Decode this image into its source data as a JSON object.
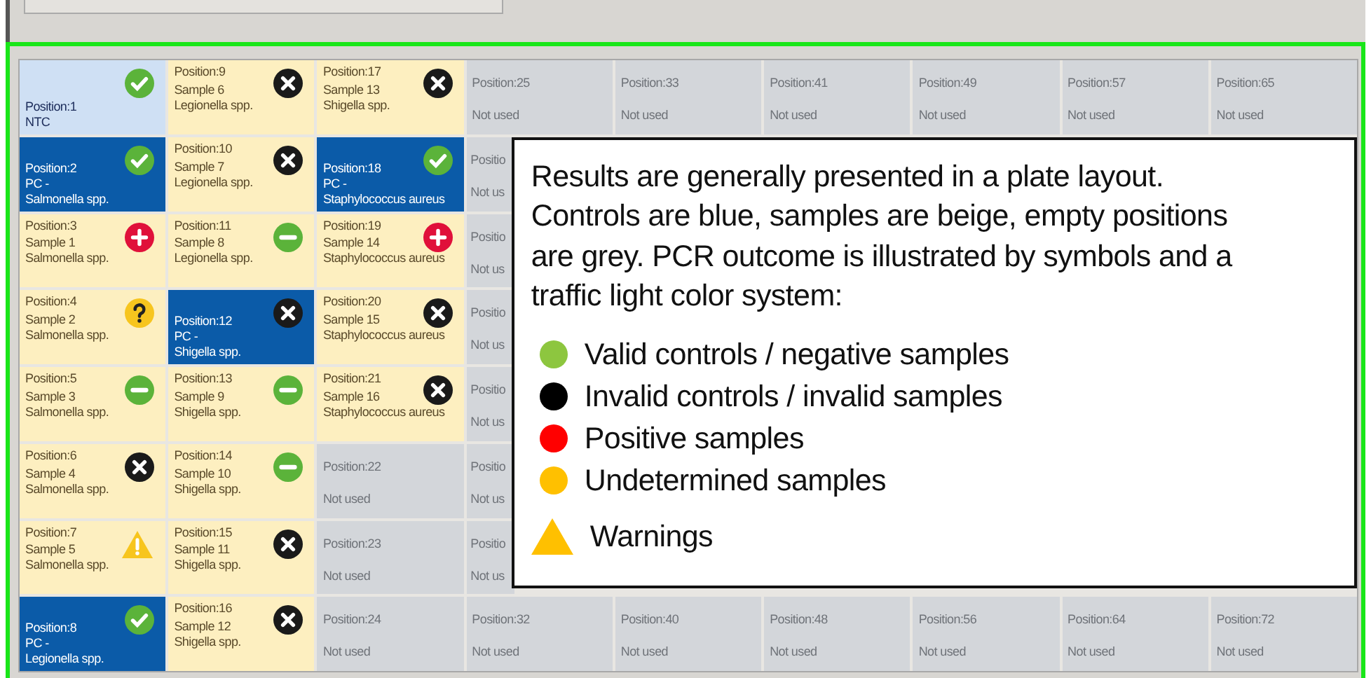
{
  "plate": {
    "columns": [
      [
        {
          "kind": "ntc",
          "position": "Position:1",
          "lines": [
            "NTC"
          ],
          "icon": {
            "kind": "check"
          }
        },
        {
          "kind": "control",
          "position": "Position:2",
          "lines": [
            "PC -",
            "Salmonella spp."
          ],
          "icon": {
            "kind": "check"
          }
        },
        {
          "kind": "sample",
          "position": "Position:3",
          "lines": [
            "Sample 1",
            "Salmonella spp."
          ],
          "icon": {
            "kind": "plus"
          }
        },
        {
          "kind": "sample",
          "position": "Position:4",
          "lines": [
            "Sample 2",
            "Salmonella spp."
          ],
          "icon": {
            "kind": "question"
          }
        },
        {
          "kind": "sample",
          "position": "Position:5",
          "lines": [
            "Sample 3",
            "Salmonella spp."
          ],
          "icon": {
            "kind": "minus"
          }
        },
        {
          "kind": "sample",
          "position": "Position:6",
          "lines": [
            "Sample 4",
            "Salmonella spp."
          ],
          "icon": {
            "kind": "cross"
          }
        },
        {
          "kind": "sample",
          "position": "Position:7",
          "lines": [
            "Sample 5",
            "Salmonella spp."
          ],
          "icon": {
            "kind": "warning"
          }
        },
        {
          "kind": "control",
          "position": "Position:8",
          "lines": [
            "PC -",
            "Legionella spp."
          ],
          "icon": {
            "kind": "check"
          }
        }
      ],
      [
        {
          "kind": "sample",
          "position": "Position:9",
          "lines": [
            "Sample 6",
            "Legionella spp."
          ],
          "icon": {
            "kind": "cross"
          }
        },
        {
          "kind": "sample",
          "position": "Position:10",
          "lines": [
            "Sample 7",
            "Legionella spp."
          ],
          "icon": {
            "kind": "cross"
          }
        },
        {
          "kind": "sample",
          "position": "Position:11",
          "lines": [
            "Sample 8",
            "Legionella spp."
          ],
          "icon": {
            "kind": "minus"
          }
        },
        {
          "kind": "control",
          "position": "Position:12",
          "lines": [
            "PC -",
            "Shigella spp."
          ],
          "icon": {
            "kind": "cross"
          }
        },
        {
          "kind": "sample",
          "position": "Position:13",
          "lines": [
            "Sample 9",
            "Shigella spp."
          ],
          "icon": {
            "kind": "minus"
          }
        },
        {
          "kind": "sample",
          "position": "Position:14",
          "lines": [
            "Sample 10",
            "Shigella spp."
          ],
          "icon": {
            "kind": "minus"
          }
        },
        {
          "kind": "sample",
          "position": "Position:15",
          "lines": [
            "Sample 11",
            "Shigella spp."
          ],
          "icon": {
            "kind": "cross"
          }
        },
        {
          "kind": "sample",
          "position": "Position:16",
          "lines": [
            "Sample 12",
            "Shigella spp."
          ],
          "icon": {
            "kind": "cross"
          }
        }
      ],
      [
        {
          "kind": "sample",
          "position": "Position:17",
          "lines": [
            "Sample 13",
            "Shigella spp."
          ],
          "icon": {
            "kind": "cross"
          }
        },
        {
          "kind": "control",
          "position": "Position:18",
          "lines": [
            "PC -",
            "Staphylococcus aureus"
          ],
          "icon": {
            "kind": "check"
          }
        },
        {
          "kind": "sample",
          "position": "Position:19",
          "lines": [
            "Sample 14",
            "Staphylococcus aureus"
          ],
          "icon": {
            "kind": "plus"
          }
        },
        {
          "kind": "sample",
          "position": "Position:20",
          "lines": [
            "Sample 15",
            "Staphylococcus aureus"
          ],
          "icon": {
            "kind": "cross"
          }
        },
        {
          "kind": "sample",
          "position": "Position:21",
          "lines": [
            "Sample 16",
            "Staphylococcus aureus"
          ],
          "icon": {
            "kind": "cross"
          }
        },
        {
          "kind": "unused",
          "position": "Position:22",
          "note": "Not used"
        },
        {
          "kind": "unused",
          "position": "Position:23",
          "note": "Not used"
        },
        {
          "kind": "unused",
          "position": "Position:24",
          "note": "Not used"
        }
      ],
      [
        {
          "kind": "unused",
          "position": "Position:25",
          "note": "Not used"
        },
        {
          "kind": "clipped",
          "position": "Positio",
          "note": "Not us"
        },
        {
          "kind": "clipped",
          "position": "Positio",
          "note": "Not us"
        },
        {
          "kind": "clipped",
          "position": "Positio",
          "note": "Not us"
        },
        {
          "kind": "clipped",
          "position": "Positio",
          "note": "Not us"
        },
        {
          "kind": "clipped",
          "position": "Positio",
          "note": "Not us"
        },
        {
          "kind": "clipped",
          "position": "Positio",
          "note": "Not us"
        },
        {
          "kind": "unused",
          "position": "Position:32",
          "note": "Not used"
        }
      ],
      [
        {
          "kind": "unused",
          "position": "Position:33",
          "note": "Not used"
        },
        {
          "kind": "covered"
        },
        {
          "kind": "covered"
        },
        {
          "kind": "covered"
        },
        {
          "kind": "covered"
        },
        {
          "kind": "covered"
        },
        {
          "kind": "covered"
        },
        {
          "kind": "unused",
          "position": "Position:40",
          "note": "Not used"
        }
      ],
      [
        {
          "kind": "unused",
          "position": "Position:41",
          "note": "Not used"
        },
        {
          "kind": "covered"
        },
        {
          "kind": "covered"
        },
        {
          "kind": "covered"
        },
        {
          "kind": "covered"
        },
        {
          "kind": "covered"
        },
        {
          "kind": "covered"
        },
        {
          "kind": "unused",
          "position": "Position:48",
          "note": "Not used"
        }
      ],
      [
        {
          "kind": "unused",
          "position": "Position:49",
          "note": "Not used"
        },
        {
          "kind": "covered"
        },
        {
          "kind": "covered"
        },
        {
          "kind": "covered"
        },
        {
          "kind": "covered"
        },
        {
          "kind": "covered"
        },
        {
          "kind": "covered"
        },
        {
          "kind": "unused",
          "position": "Position:56",
          "note": "Not used"
        }
      ],
      [
        {
          "kind": "unused",
          "position": "Position:57",
          "note": "Not used"
        },
        {
          "kind": "covered"
        },
        {
          "kind": "covered"
        },
        {
          "kind": "covered"
        },
        {
          "kind": "covered"
        },
        {
          "kind": "covered"
        },
        {
          "kind": "covered"
        },
        {
          "kind": "unused",
          "position": "Position:64",
          "note": "Not used"
        }
      ],
      [
        {
          "kind": "unused",
          "position": "Position:65",
          "note": "Not used"
        },
        {
          "kind": "covered"
        },
        {
          "kind": "covered"
        },
        {
          "kind": "covered"
        },
        {
          "kind": "covered"
        },
        {
          "kind": "covered"
        },
        {
          "kind": "covered"
        },
        {
          "kind": "unused",
          "position": "Position:72",
          "note": "Not used"
        }
      ]
    ]
  },
  "callout": {
    "text": "Results are generally presented in a plate layout. Controls are blue, samples are beige, empty positions are grey. PCR outcome is illustrated by symbols and a traffic light color system:",
    "legend": [
      {
        "kind": "dot",
        "color": "#8dc63f",
        "label": "Valid controls / negative samples"
      },
      {
        "kind": "dot",
        "color": "#000000",
        "label": "Invalid controls / invalid samples"
      },
      {
        "kind": "dot",
        "color": "#ff0000",
        "label": "Positive samples"
      },
      {
        "kind": "dot",
        "color": "#ffc000",
        "label": "Undetermined samples"
      },
      {
        "kind": "triangle",
        "color": "#ffc000",
        "label": "Warnings"
      }
    ]
  }
}
